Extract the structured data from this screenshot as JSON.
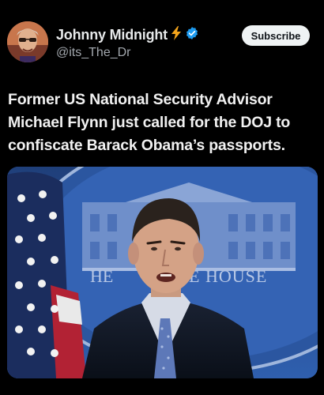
{
  "post": {
    "author_name": "Johnny Midnight",
    "handle": "@its_The_Dr",
    "subscribe_label": "Subscribe",
    "text": "Former US National Security Advisor Michael Flynn just called for the DOJ to confiscate Barack Obama’s passports."
  },
  "media": {
    "backdrop_words": [
      "HE",
      "E HOUSE"
    ]
  },
  "icons": [
    "lightning-icon",
    "verified-badge-icon"
  ],
  "colors": {
    "background": "#000000",
    "verified_blue": "#1d9bf0",
    "lightning_orange": "#f4a51c",
    "backdrop_blue": "#2d5aa8"
  }
}
